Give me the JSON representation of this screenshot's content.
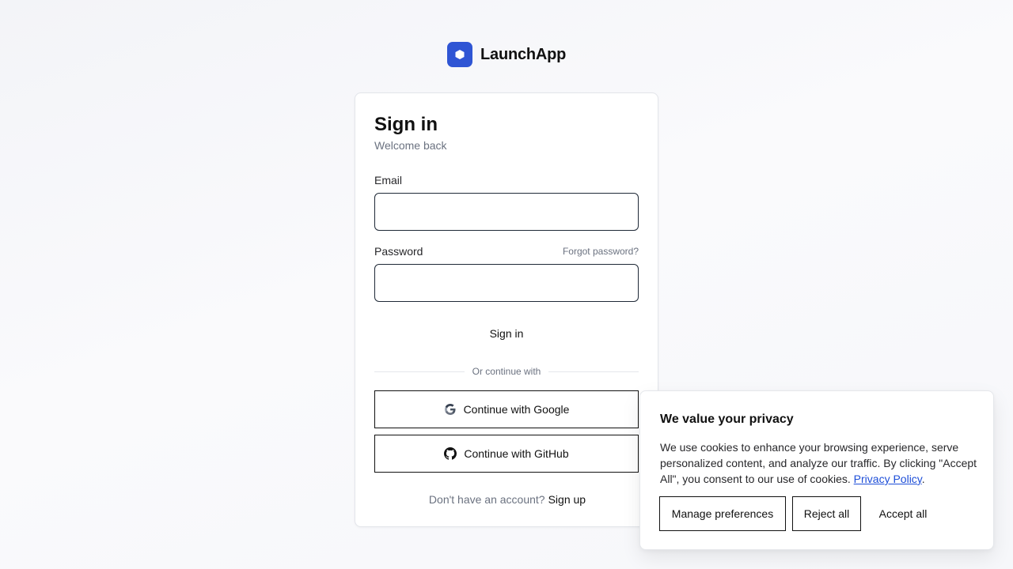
{
  "brand": {
    "name": "LaunchApp",
    "logo_icon": "cube-icon",
    "accent": "#2f55d4"
  },
  "signin": {
    "title": "Sign in",
    "subtitle": "Welcome back",
    "email_label": "Email",
    "email_value": "",
    "password_label": "Password",
    "password_value": "",
    "forgot_label": "Forgot password?",
    "submit_label": "Sign in",
    "divider_text": "Or continue with",
    "google_label": "Continue with Google",
    "github_label": "Continue with GitHub",
    "signup_prompt": "Don't have an account?",
    "signup_link": "Sign up"
  },
  "cookie": {
    "title": "We value your privacy",
    "body": "We use cookies to enhance your browsing experience, serve personalized content, and analyze our traffic. By clicking \"Accept All\", you consent to our use of cookies.",
    "link_text": "Privacy Policy",
    "body_end": ".",
    "manage_label": "Manage preferences",
    "reject_label": "Reject all",
    "accept_label": "Accept all",
    "link_color": "#1d4ed8"
  }
}
